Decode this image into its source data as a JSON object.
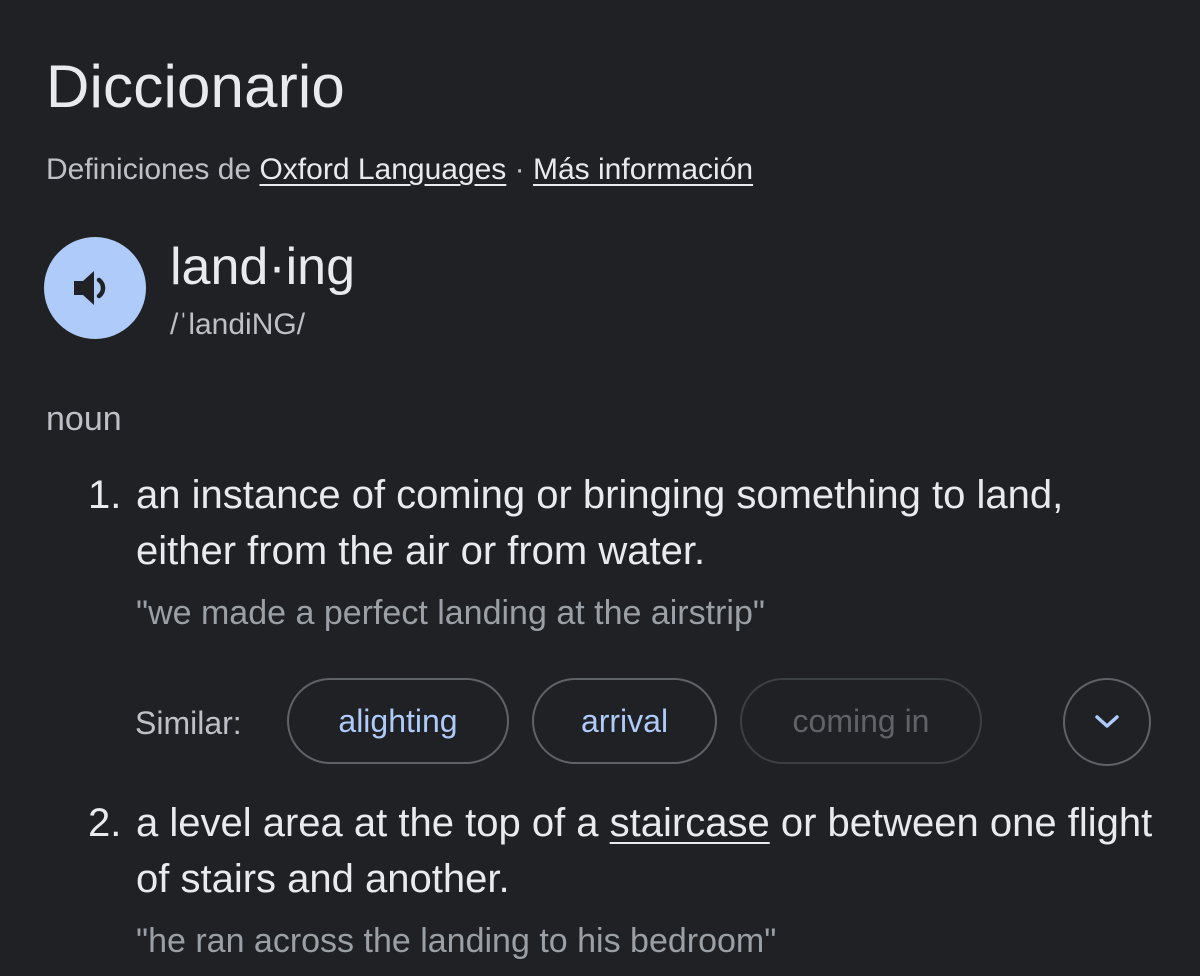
{
  "header": {
    "title": "Diccionario",
    "source_prefix": "Definiciones de",
    "source_link": "Oxford Languages",
    "separator": "·",
    "more_info_link": "Más información"
  },
  "entry": {
    "headword": "land·ing",
    "phonetic": "/ˈlandiNG/",
    "part_of_speech": "noun",
    "speaker_icon": "volume-up-icon"
  },
  "senses": [
    {
      "number": "1.",
      "definition": "an instance of coming or bringing something to land, either from the air or from water.",
      "example": "\"we made a perfect landing at the airstrip\"",
      "similar_label": "Similar:",
      "similar": [
        "alighting",
        "arrival",
        "coming in"
      ],
      "expand_icon": "chevron-down-icon"
    },
    {
      "number": "2.",
      "definition_before": "a level area at the top of a ",
      "definition_link": "staircase",
      "definition_after": " or between one flight of stairs and another.",
      "example": "\"he ran across the landing to his bedroom\""
    }
  ],
  "colors": {
    "background": "#202124",
    "text_primary": "#e8eaed",
    "text_secondary": "#bdc1c6",
    "text_example": "#9aa0a6",
    "accent": "#aecbfa",
    "chip_border": "#5f6368"
  }
}
